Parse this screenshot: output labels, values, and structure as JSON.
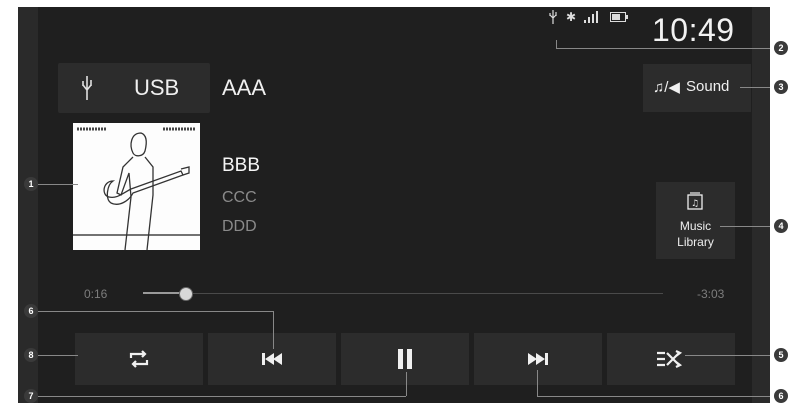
{
  "status": {
    "usb_icon": "usb-icon",
    "bluetooth_icon": "bluetooth-icon",
    "signal_icon": "signal-icon",
    "battery_icon": "battery-icon",
    "clock": "10:49"
  },
  "source": {
    "label": "USB",
    "name": "AAA"
  },
  "sound": {
    "label": "Sound"
  },
  "track": {
    "title": "BBB",
    "artist": "CCC",
    "album": "DDD"
  },
  "library": {
    "line1": "Music",
    "line2": "Library"
  },
  "progress": {
    "elapsed": "0:16",
    "remaining": "-3:03",
    "fraction": 0.08
  },
  "controls": [
    "repeat",
    "previous",
    "pause",
    "next",
    "shuffle"
  ],
  "callouts": [
    "1",
    "2",
    "3",
    "4",
    "5",
    "6",
    "7",
    "8"
  ]
}
